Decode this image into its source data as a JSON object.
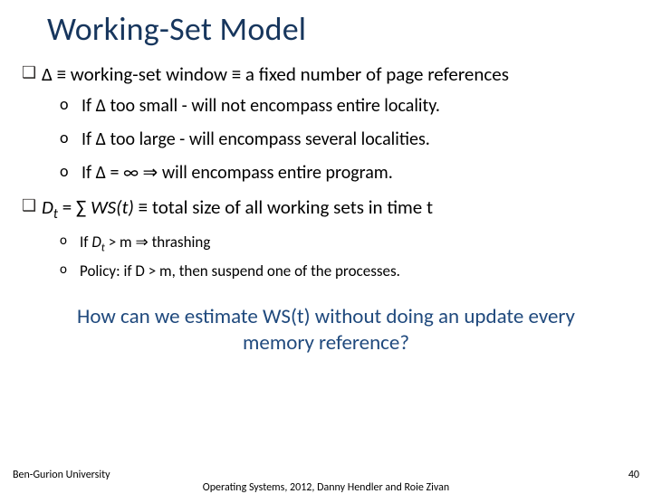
{
  "title": "Working-Set Model",
  "bullets": {
    "a": {
      "sym": "❑",
      "text_pre": "Δ ≡ working-set window ≡ a fixed number of page references"
    },
    "a1": {
      "sym": "o",
      "text": "If Δ too small - will not encompass entire locality."
    },
    "a2": {
      "sym": "o",
      "text": "If Δ too large - will encompass several localities."
    },
    "a3": {
      "sym": "o",
      "text": "If Δ = ∞ ⇒ will encompass entire program."
    },
    "b": {
      "sym": "❑",
      "d": "D",
      "t": "t",
      "eq": " = ∑ ",
      "ws": "WS(t)",
      "rest": " ≡ total size of all working sets in time t"
    },
    "b1": {
      "sym": "o",
      "pre": "If ",
      "d": "D",
      "t": "t",
      "post": " > m ⇒ thrashing"
    },
    "b2": {
      "sym": "o",
      "text": "Policy: if D > m, then suspend one of the processes."
    }
  },
  "question": "How can we estimate WS(t) without doing an update every memory reference?",
  "footer": {
    "left": "Ben-Gurion University",
    "center": "Operating Systems, 2012, Danny Hendler and Roie Zivan",
    "right": "40"
  }
}
